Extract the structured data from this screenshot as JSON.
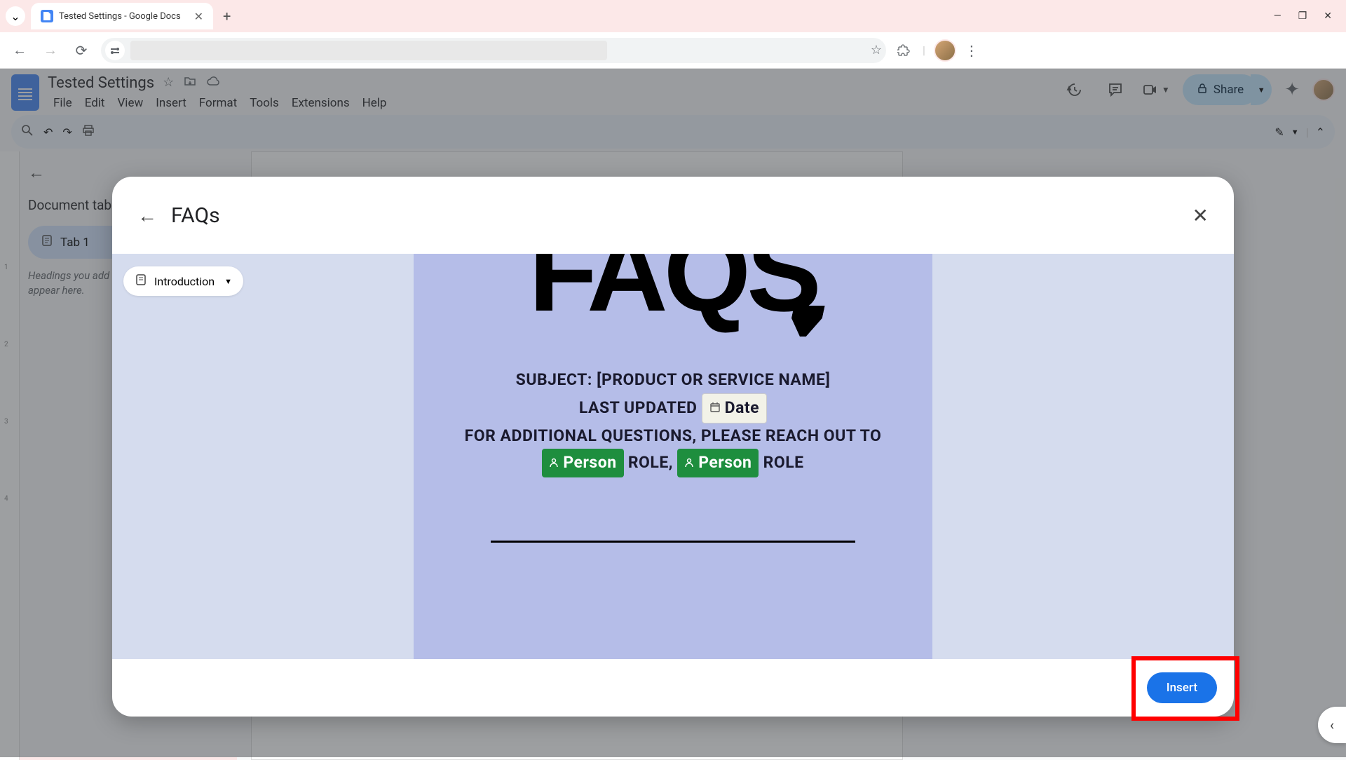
{
  "browser": {
    "tab_title": "Tested Settings - Google Docs",
    "window": {
      "min": "—",
      "max": "❐",
      "close": "✕"
    }
  },
  "docs": {
    "title": "Tested Settings",
    "menu": [
      "File",
      "Edit",
      "View",
      "Insert",
      "Format",
      "Tools",
      "Extensions",
      "Help"
    ],
    "share_label": "Share"
  },
  "outline": {
    "title": "Document tabs",
    "tab1": "Tab 1",
    "hint": "Headings you add to the document will appear here."
  },
  "modal": {
    "title": "FAQs",
    "section_pill": "Introduction",
    "insert_label": "Insert",
    "preview": {
      "big": "FAQS",
      "line1": "SUBJECT: [PRODUCT OR SERVICE NAME]",
      "line2_prefix": "LAST UPDATED",
      "date_chip": "Date",
      "line3": "FOR ADDITIONAL QUESTIONS, PLEASE REACH OUT TO",
      "person_chip": "Person",
      "role_label": "ROLE"
    }
  }
}
